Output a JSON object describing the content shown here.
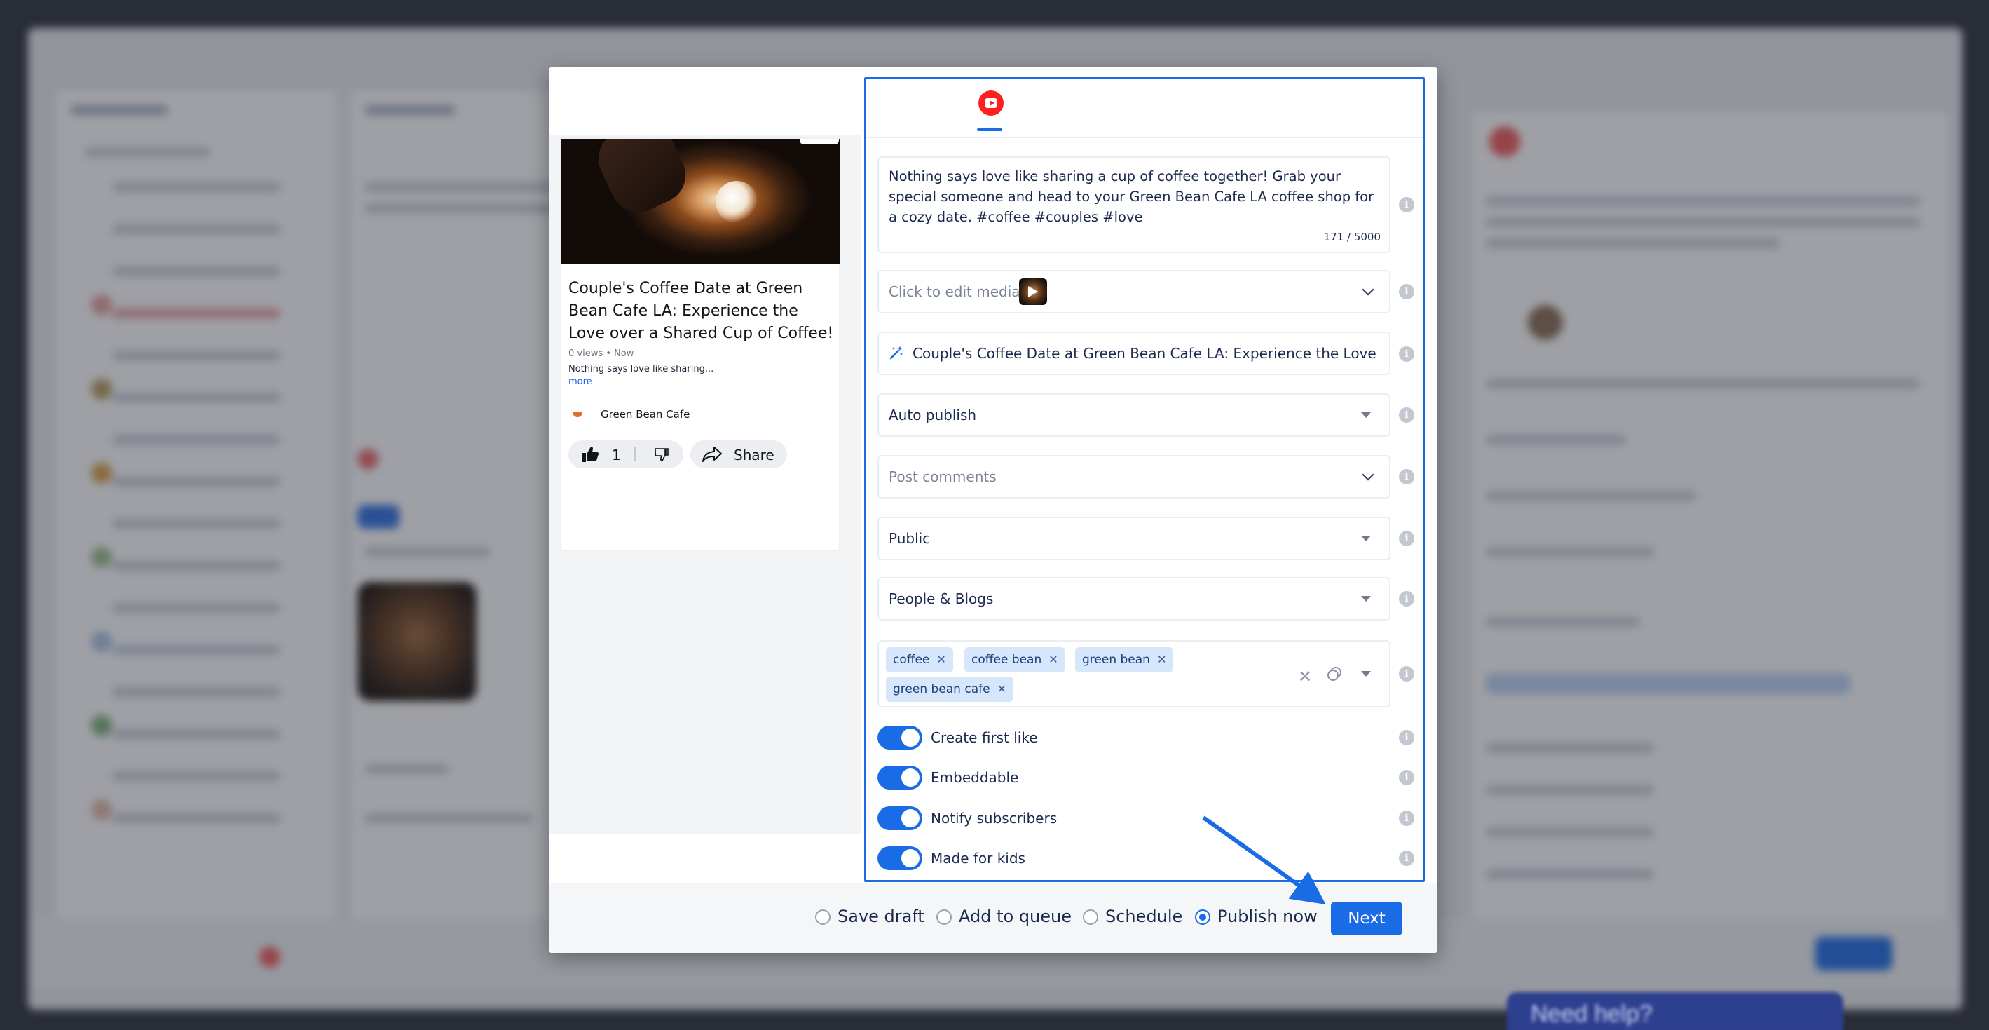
{
  "preview": {
    "video_title": "Couple's Coffee Date at Green Bean Cafe LA: Experience the Love over a Shared Cup of Coffee!",
    "meta": "0 views • Now",
    "description_snippet": "Nothing says love like sharing...",
    "more_label": "more",
    "channel_name": "Green Bean Cafe",
    "like_count": "1",
    "share_label": "Share"
  },
  "editor": {
    "platform_icon": "youtube-icon",
    "description": "Nothing says love like sharing a cup of coffee together! Grab your special someone and head to your Green Bean Cafe LA coffee shop for a cozy date. #coffee #couples #love",
    "char_count": "171 / 5000",
    "media_placeholder": "Click to edit media",
    "title_value": "Couple's Coffee Date at Green Bean Cafe LA: Experience the Love over a Shared Cup of Coffee!",
    "publish_mode": "Auto publish",
    "comments_placeholder": "Post comments",
    "visibility": "Public",
    "category": "People & Blogs",
    "tags": [
      "coffee",
      "coffee bean",
      "green bean",
      "green bean cafe"
    ],
    "toggles": [
      {
        "label": "Create first like",
        "on": true
      },
      {
        "label": "Embeddable",
        "on": true
      },
      {
        "label": "Notify subscribers",
        "on": true
      },
      {
        "label": "Made for kids",
        "on": true
      }
    ]
  },
  "footer": {
    "options": [
      "Save draft",
      "Add to queue",
      "Schedule",
      "Publish now"
    ],
    "selected": "Publish now",
    "next_label": "Next"
  },
  "background": {
    "help_label": "Need help?"
  },
  "colors": {
    "accent": "#1a6be6",
    "youtube_red": "#ff1f1f",
    "tag_bg": "#d6e6fb"
  }
}
